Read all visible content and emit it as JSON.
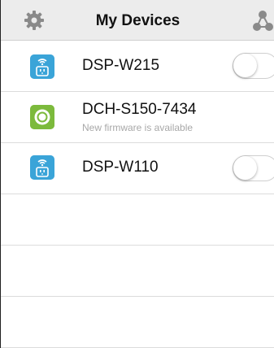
{
  "header": {
    "title": "My Devices",
    "left_icon": "gear-icon",
    "right_icon": "share-nodes-icon"
  },
  "devices": [
    {
      "name": "DSP-W215",
      "subtitle": "",
      "icon": "smart-plug-icon",
      "toggle_on": false
    },
    {
      "name": "DCH-S150-7434",
      "subtitle": "New firmware is available",
      "icon": "motion-sensor-icon"
    },
    {
      "name": "DSP-W110",
      "subtitle": "",
      "icon": "smart-plug-icon",
      "toggle_on": false
    }
  ],
  "colors": {
    "plug": "#3aa4d8",
    "sensor": "#7cba3c",
    "header_bg": "#ececec"
  }
}
